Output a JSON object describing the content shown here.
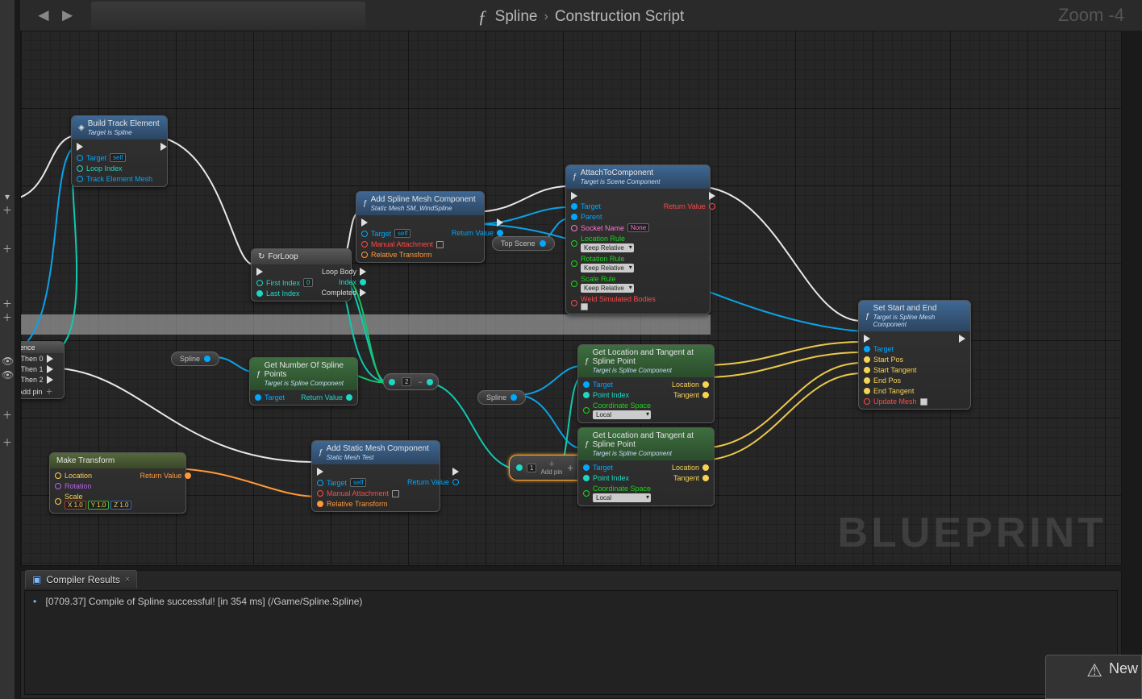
{
  "breadcrumb": {
    "blueprint": "Spline",
    "graph": "Construction Script"
  },
  "zoom": "Zoom -4",
  "watermark": "BLUEPRINT",
  "compiler": {
    "tab": "Compiler Results",
    "msg": "[0709.37] Compile of Spline successful! [in 354 ms] (/Game/Spline.Spline)"
  },
  "toast": "New",
  "dropdowns": {
    "keep_rel": "Keep Relative",
    "local": "Local"
  },
  "inputs": {
    "zero": "0",
    "two": "2",
    "self": "self",
    "none": "None",
    "one": "1.0"
  },
  "nodes": {
    "seq": {
      "title": "ence",
      "p0": "Then 0",
      "p1": "Then 1",
      "p2": "Then 2",
      "add": "Add pin"
    },
    "build": {
      "title": "Build Track Element",
      "sub": "Target is Spline",
      "target": "Target",
      "self": "self",
      "loop": "Loop Index",
      "mesh": "Track Element Mesh"
    },
    "forloop": {
      "title": "ForLoop",
      "first": "First Index",
      "last": "Last Index",
      "loopbody": "Loop Body",
      "index": "Index",
      "completed": "Completed"
    },
    "addspline": {
      "title": "Add Spline Mesh Component",
      "sub": "Static Mesh SM_WindSpline",
      "target": "Target",
      "manual": "Manual Attachment",
      "rt": "Relative Transform",
      "ret": "Return Value"
    },
    "addstatic": {
      "title": "Add Static Mesh Component",
      "sub": "Static Mesh Test",
      "target": "Target",
      "manual": "Manual Attachment",
      "rt": "Relative Transform",
      "ret": "Return Value"
    },
    "attach": {
      "title": "AttachToComponent",
      "sub": "Target is Scene Component",
      "target": "Target",
      "parent": "Parent",
      "socket": "Socket Name",
      "lrule": "Location Rule",
      "rrule": "Rotation Rule",
      "srule": "Scale Rule",
      "weld": "Weld Simulated Bodies",
      "ret": "Return Value"
    },
    "getnum": {
      "title": "Get Number Of Spline Points",
      "sub": "Target is Spline Component",
      "target": "Target",
      "ret": "Return Value"
    },
    "make": {
      "title": "Make Transform",
      "loc": "Location",
      "rot": "Rotation",
      "scale": "Scale",
      "ret": "Return Value"
    },
    "getlt": {
      "title": "Get Location and Tangent at Spline Point",
      "sub": "Target is Spline Component",
      "target": "Target",
      "pidx": "Point Index",
      "coord": "Coordinate Space",
      "loc": "Location",
      "tan": "Tangent"
    },
    "setse": {
      "title": "Set Start and End",
      "sub": "Target is Spline Mesh Component",
      "target": "Target",
      "spos": "Start Pos",
      "stan": "Start Tangent",
      "epos": "End Pos",
      "etan": "End Tangent",
      "upd": "Update Mesh"
    },
    "spline_pill": "Spline",
    "topscene_pill": "Top Scene",
    "addpin": "Add pin"
  }
}
